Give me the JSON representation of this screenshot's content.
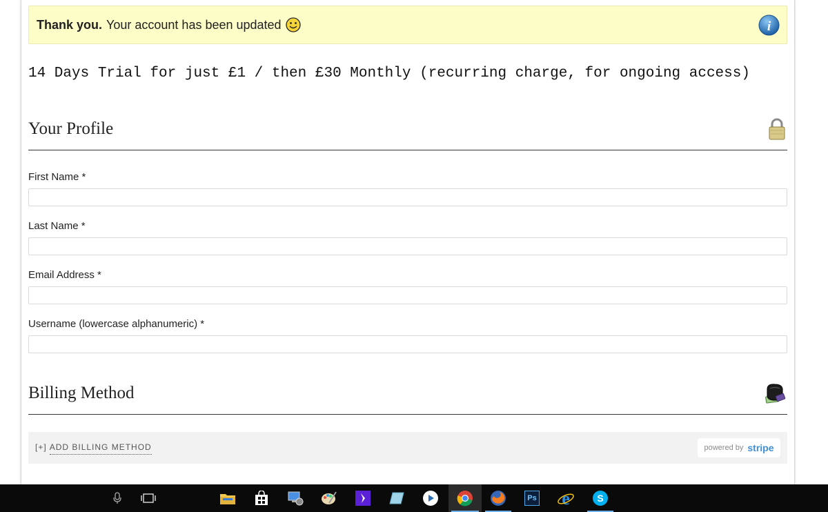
{
  "notice": {
    "strong": "Thank you.",
    "text": "Your account has been updated",
    "smiley_icon": "smiley-face-icon",
    "info_icon": "info-icon"
  },
  "trial_text": "14 Days Trial for just £1 / then £30 Monthly (recurring charge, for ongoing access)",
  "profile": {
    "title": "Your Profile",
    "icon": "padlock-icon",
    "fields": [
      {
        "label": "First Name *",
        "value": "",
        "placeholder": ""
      },
      {
        "label": "Last Name *",
        "value": "",
        "placeholder": ""
      },
      {
        "label": "Email Address *",
        "value": "",
        "placeholder": ""
      },
      {
        "label": "Username (lowercase alphanumeric) *",
        "value": "",
        "placeholder": ""
      }
    ]
  },
  "billing": {
    "title": "Billing Method",
    "icon": "wallet-icon",
    "add_prefix": "[+]",
    "add_label": "ADD BILLING METHOD",
    "powered_by": "powered by",
    "stripe": "stripe"
  },
  "taskbar": {
    "items": [
      {
        "name": "microphone-icon"
      },
      {
        "name": "task-view-icon"
      },
      {
        "name": "file-explorer-icon"
      },
      {
        "name": "store-icon"
      },
      {
        "name": "remote-desktop-icon"
      },
      {
        "name": "paint-icon"
      },
      {
        "name": "app-icon"
      },
      {
        "name": "notes-icon"
      },
      {
        "name": "media-player-icon"
      },
      {
        "name": "chrome-icon"
      },
      {
        "name": "firefox-icon"
      },
      {
        "name": "photoshop-icon",
        "label": "Ps"
      },
      {
        "name": "internet-explorer-icon"
      },
      {
        "name": "skype-icon"
      }
    ]
  }
}
